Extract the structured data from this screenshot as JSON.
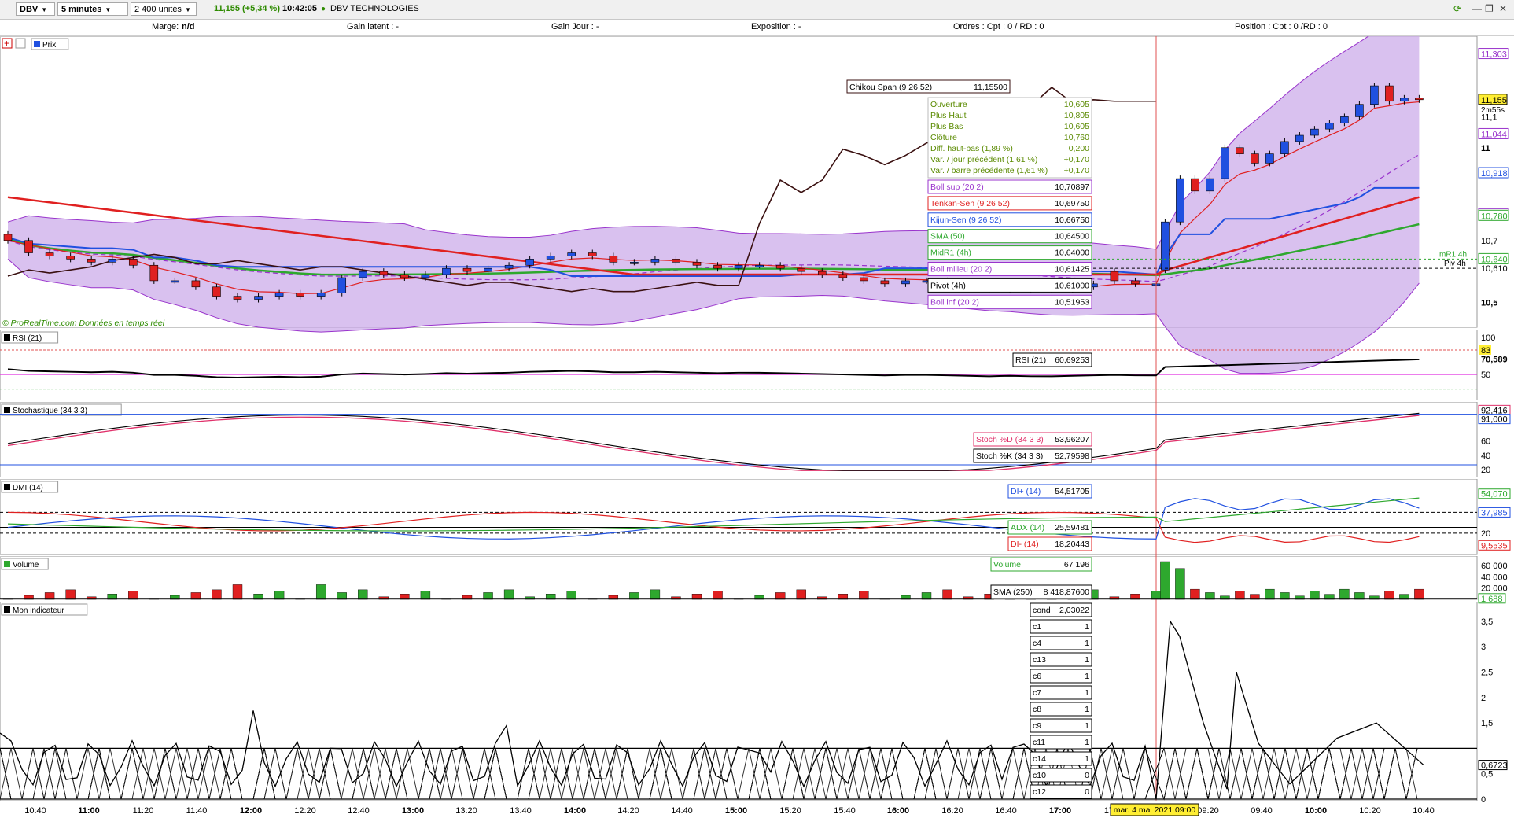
{
  "toolbar": {
    "symbol": "DBV",
    "timeframe": "5 minutes",
    "units": "2 400 unités",
    "price": "11,155",
    "change": "(+5,34 %)",
    "time": "10:42:05",
    "name": "DBV TECHNOLOGIES"
  },
  "infobar": {
    "marge_label": "Marge:",
    "marge_value": "n/d",
    "gain_latent": "Gain latent : -",
    "gain_jour": "Gain Jour : -",
    "exposition": "Exposition : -",
    "ordres": "Ordres : Cpt : 0 / RD : 0",
    "position": "Position : Cpt : 0 /RD : 0"
  },
  "panels": {
    "price": "Prix",
    "rsi": "RSI (21)",
    "stoch": "Stochastique (34 3 3)",
    "dmi": "DMI (14)",
    "volume": "Volume",
    "custom": "Mon indicateur"
  },
  "credit": "© ProRealTime.com  Données en temps réel",
  "price_tooltip": [
    {
      "label": "Ouverture",
      "value": "10,605",
      "color": "#5a8a00"
    },
    {
      "label": "Plus Haut",
      "value": "10,805",
      "color": "#5a8a00"
    },
    {
      "label": "Plus Bas",
      "value": "10,605",
      "color": "#5a8a00"
    },
    {
      "label": "Clôture",
      "value": "10,760",
      "color": "#5a8a00"
    },
    {
      "label": "Diff. haut-bas (1,89 %)",
      "value": "0,200",
      "color": "#5a8a00"
    },
    {
      "label": "Var. / jour précédent (1,61 %)",
      "value": "+0,170",
      "color": "#5a8a00"
    },
    {
      "label": "Var. / barre précédente (1,61 %)",
      "value": "+0,170",
      "color": "#5a8a00"
    }
  ],
  "chikou_box": {
    "label": "Chikou Span (9 26 52)",
    "value": "11,15500"
  },
  "indicator_boxes": [
    {
      "label": "Boll sup (20 2)",
      "value": "10,70897",
      "color": "#9933cc"
    },
    {
      "label": "Tenkan-Sen (9 26 52)",
      "value": "10,69750",
      "color": "#e02020"
    },
    {
      "label": "Kijun-Sen (9 26 52)",
      "value": "10,66750",
      "color": "#2050e0"
    },
    {
      "label": "SMA (50)",
      "value": "10,64500",
      "color": "#2ea82e"
    },
    {
      "label": "MidR1 (4h)",
      "value": "10,64000",
      "color": "#2ea82e"
    },
    {
      "label": "Boll milieu (20 2)",
      "value": "10,61425",
      "color": "#9933cc"
    },
    {
      "label": "Pivot (4h)",
      "value": "10,61000",
      "color": "#000000"
    },
    {
      "label": "Boll inf (20 2)",
      "value": "10,51953",
      "color": "#9933cc"
    }
  ],
  "rsi_box": {
    "label": "RSI (21)",
    "value": "60,69253"
  },
  "stoch_boxes": [
    {
      "label": "Stoch %D (34 3 3)",
      "value": "53,96207",
      "color": "#e0306a"
    },
    {
      "label": "Stoch %K (34 3 3)",
      "value": "52,79598",
      "color": "#000000"
    }
  ],
  "dmi_boxes": [
    {
      "label": "DI+ (14)",
      "value": "54,51705",
      "color": "#2050e0"
    },
    {
      "label": "ADX (14)",
      "value": "25,59481",
      "color": "#2ea82e"
    },
    {
      "label": "DI- (14)",
      "value": "18,20443",
      "color": "#e02020"
    }
  ],
  "volume_boxes": [
    {
      "label": "Volume",
      "value": "67 196",
      "color": "#2ea82e"
    },
    {
      "label": "SMA (250)",
      "value": "8 418,87600",
      "color": "#000000"
    }
  ],
  "custom_boxes": [
    {
      "label": "cond",
      "value": "2,03022"
    },
    {
      "label": "c1",
      "value": "1"
    },
    {
      "label": "c4",
      "value": "1"
    },
    {
      "label": "c13",
      "value": "1"
    },
    {
      "label": "c6",
      "value": "1"
    },
    {
      "label": "c7",
      "value": "1"
    },
    {
      "label": "c8",
      "value": "1"
    },
    {
      "label": "c9",
      "value": "1"
    },
    {
      "label": "c11",
      "value": "1"
    },
    {
      "label": "c14",
      "value": "1"
    },
    {
      "label": "c10",
      "value": "0"
    },
    {
      "label": "c12",
      "value": "0"
    }
  ],
  "price_axis": {
    "ticks": [
      "11,303",
      "11,1",
      "11,044",
      "11",
      "10,918",
      "10,785",
      "10,780",
      "10,7",
      "10,640",
      "10,610",
      "10,5"
    ],
    "current": "11,155",
    "countdown": "2m55s",
    "level_labels": [
      "mR1 4h",
      "Piv 4h"
    ]
  },
  "rsi_axis": {
    "ticks": [
      "100",
      "83",
      "70,589",
      "50"
    ]
  },
  "stoch_axis": {
    "ticks": [
      "92,416",
      "91,000",
      "60",
      "40",
      "20"
    ]
  },
  "dmi_axis": {
    "ticks": [
      "54,070",
      "37,985",
      "20",
      "9,5535"
    ]
  },
  "volume_axis": {
    "ticks": [
      "60 000",
      "40 000",
      "20 000",
      "1 688"
    ]
  },
  "custom_axis": {
    "ticks": [
      "3,5",
      "3",
      "2,5",
      "2",
      "1,5",
      "0,6723",
      "0,5",
      "0"
    ]
  },
  "time_axis": {
    "labels": [
      "10:40",
      "11:00",
      "11:20",
      "11:40",
      "12:00",
      "12:20",
      "12:40",
      "13:00",
      "13:20",
      "13:40",
      "14:00",
      "14:20",
      "14:40",
      "15:00",
      "15:20",
      "15:40",
      "16:00",
      "16:20",
      "16:40",
      "17:00",
      "17",
      "09:20",
      "09:40",
      "10:00",
      "10:20",
      "10:40"
    ],
    "bold": [
      "11:00",
      "12:00",
      "13:00",
      "14:00",
      "15:00",
      "16:00",
      "17:00",
      "10:00"
    ],
    "cursor": "mar. 4 mai 2021 09:00"
  },
  "colors": {
    "up": "#2050e0",
    "down": "#e02020",
    "boll_fill": "#c9a6e8",
    "boll_line": "#9933cc",
    "kijun": "#2050e0",
    "tenkan": "#e02020",
    "sma": "#2ea82e",
    "chikou": "#3a1010"
  },
  "chart_data": {
    "type": "candlestick",
    "candles_open_close": [
      [
        10.72,
        10.7
      ],
      [
        10.7,
        10.66
      ],
      [
        10.66,
        10.65
      ],
      [
        10.65,
        10.64
      ],
      [
        10.64,
        10.63
      ],
      [
        10.63,
        10.64
      ],
      [
        10.64,
        10.62
      ],
      [
        10.62,
        10.57
      ],
      [
        10.57,
        10.57
      ],
      [
        10.57,
        10.55
      ],
      [
        10.55,
        10.52
      ],
      [
        10.52,
        10.51
      ],
      [
        10.51,
        10.52
      ],
      [
        10.52,
        10.53
      ],
      [
        10.53,
        10.52
      ],
      [
        10.52,
        10.53
      ],
      [
        10.53,
        10.58
      ],
      [
        10.58,
        10.6
      ],
      [
        10.6,
        10.59
      ],
      [
        10.59,
        10.58
      ],
      [
        10.58,
        10.59
      ],
      [
        10.59,
        10.61
      ],
      [
        10.61,
        10.6
      ],
      [
        10.6,
        10.61
      ],
      [
        10.61,
        10.62
      ],
      [
        10.62,
        10.64
      ],
      [
        10.64,
        10.65
      ],
      [
        10.65,
        10.66
      ],
      [
        10.66,
        10.65
      ],
      [
        10.65,
        10.63
      ],
      [
        10.63,
        10.63
      ],
      [
        10.63,
        10.64
      ],
      [
        10.64,
        10.63
      ],
      [
        10.63,
        10.62
      ],
      [
        10.62,
        10.61
      ],
      [
        10.61,
        10.62
      ],
      [
        10.62,
        10.62
      ],
      [
        10.62,
        10.61
      ],
      [
        10.61,
        10.6
      ],
      [
        10.6,
        10.59
      ],
      [
        10.59,
        10.58
      ],
      [
        10.58,
        10.57
      ],
      [
        10.57,
        10.56
      ],
      [
        10.56,
        10.57
      ],
      [
        10.57,
        10.57
      ],
      [
        10.57,
        10.56
      ],
      [
        10.56,
        10.55
      ],
      [
        10.55,
        10.54
      ],
      [
        10.54,
        10.55
      ],
      [
        10.55,
        10.54
      ],
      [
        10.54,
        10.54
      ],
      [
        10.54,
        10.55
      ],
      [
        10.55,
        10.56
      ],
      [
        10.6,
        10.57
      ],
      [
        10.57,
        10.56
      ],
      [
        10.56,
        10.56
      ],
      [
        10.605,
        10.76
      ],
      [
        10.76,
        10.9
      ],
      [
        10.9,
        10.86
      ],
      [
        10.86,
        10.9
      ],
      [
        10.9,
        11.0
      ],
      [
        11.0,
        10.98
      ],
      [
        10.98,
        10.95
      ],
      [
        10.95,
        10.98
      ],
      [
        10.98,
        11.02
      ],
      [
        11.02,
        11.04
      ],
      [
        11.04,
        11.06
      ],
      [
        11.06,
        11.08
      ],
      [
        11.08,
        11.1
      ],
      [
        11.1,
        11.14
      ],
      [
        11.14,
        11.2
      ],
      [
        11.2,
        11.15
      ],
      [
        11.15,
        11.16
      ],
      [
        11.16,
        11.155
      ]
    ],
    "rsi_last": 60.69253,
    "volume_sma": 8418.876,
    "cursor_time": "mar. 4 mai 2021 09:00"
  }
}
